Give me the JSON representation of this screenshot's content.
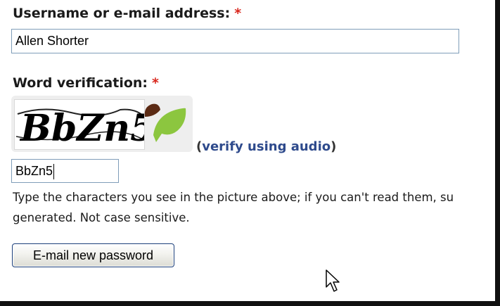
{
  "form": {
    "username_label": "Username or e-mail address:",
    "username_required": "*",
    "username_value": "Allen Shorter",
    "verification_label": "Word verification:",
    "verification_required": "*",
    "captcha_image_text": "BbZn5",
    "audio_link_open": "(",
    "audio_link_label": "verify using audio",
    "audio_link_close": ")",
    "captcha_value": "BbZn5",
    "help_line_1": "Type the characters you see in the picture above; if you can't read them, su",
    "help_line_2": "generated. Not case sensitive.",
    "submit_label": "E-mail new password"
  },
  "icons": {
    "captcha_logo": "leaf-icon",
    "pointer": "mouse-pointer-icon"
  },
  "colors": {
    "required_mark": "#d9261c",
    "link": "#2e4a8c",
    "input_border": "#7f9db9",
    "button_border": "#1c3f7a",
    "leaf_green": "#8cc63f",
    "leaf_brown": "#5b2a14"
  }
}
